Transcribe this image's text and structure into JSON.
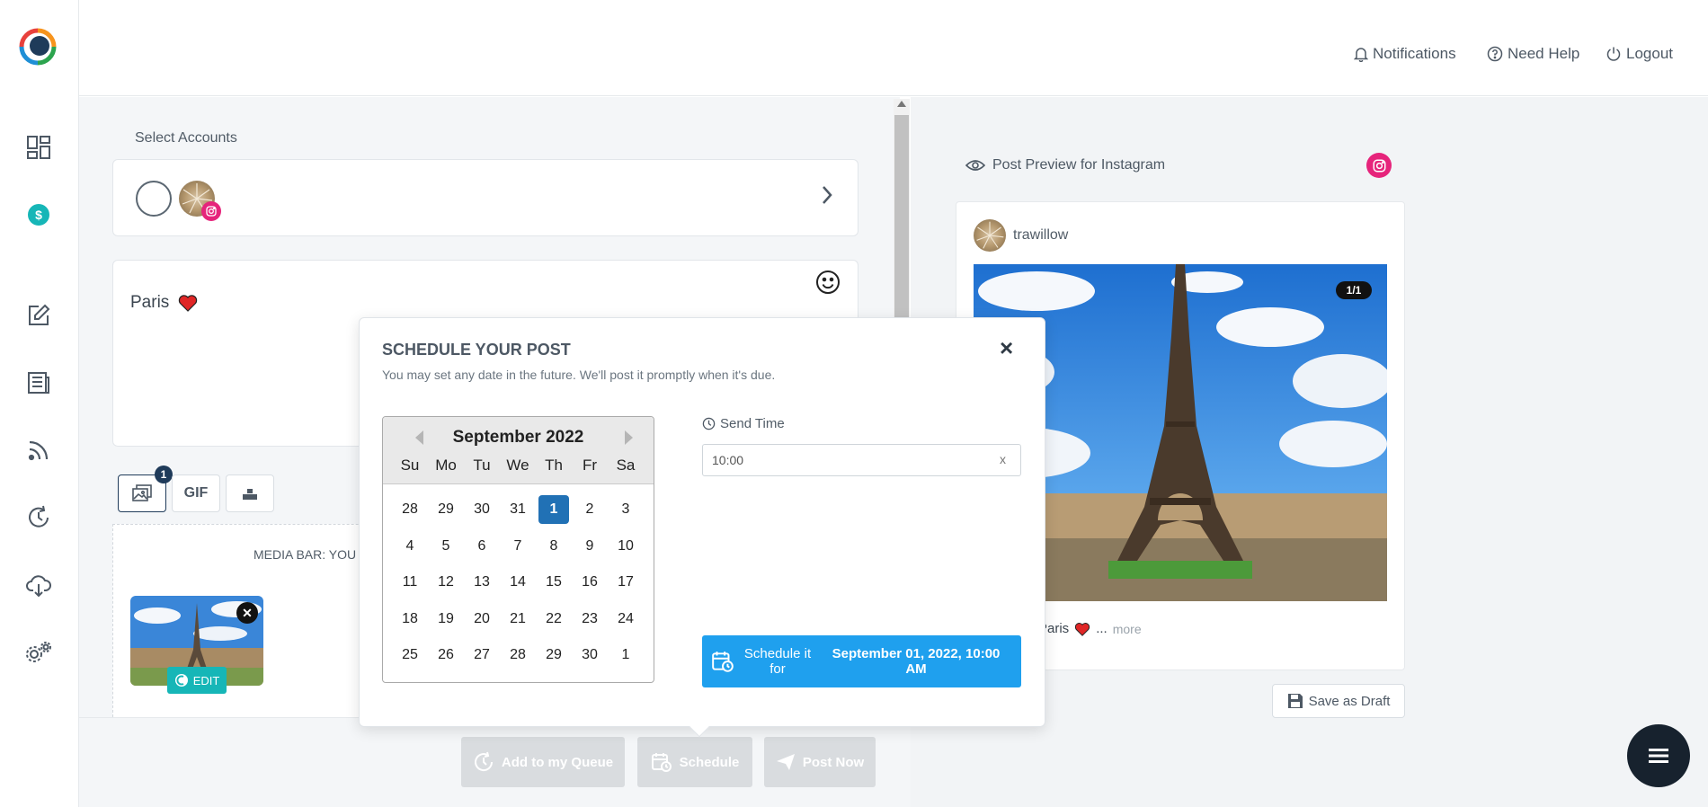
{
  "topbar": {
    "notifications": "Notifications",
    "help": "Need Help",
    "logout": "Logout"
  },
  "compose": {
    "select_accounts_label": "Select Accounts",
    "post_text": "Paris",
    "media_count": "1",
    "gif_label": "GIF",
    "media_bar_text": "MEDIA BAR: YOU",
    "edit_label": "EDIT"
  },
  "actions": {
    "queue": "Add to my Queue",
    "schedule": "Schedule",
    "post_now": "Post Now"
  },
  "preview": {
    "title": "Post Preview for Instagram",
    "username": "trawillow",
    "counter": "1/1",
    "caption": "Paris",
    "ellipsis": "...",
    "more": "more",
    "save_draft": "Save as Draft"
  },
  "modal": {
    "title": "SCHEDULE YOUR POST",
    "subtitle": "You may set any date in the future. We'll post it promptly when it's due.",
    "close": "×",
    "send_time_label": "Send Time",
    "send_time_value": "10:00",
    "clear": "x",
    "schedule_btn_line1": "Schedule it for",
    "schedule_btn_line2": "September 01, 2022, 10:00 AM"
  },
  "calendar": {
    "month": "September 2022",
    "dow": [
      "Su",
      "Mo",
      "Tu",
      "We",
      "Th",
      "Fr",
      "Sa"
    ],
    "weeks": [
      [
        "28",
        "29",
        "30",
        "31",
        "1",
        "2",
        "3"
      ],
      [
        "4",
        "5",
        "6",
        "7",
        "8",
        "9",
        "10"
      ],
      [
        "11",
        "12",
        "13",
        "14",
        "15",
        "16",
        "17"
      ],
      [
        "18",
        "19",
        "20",
        "21",
        "22",
        "23",
        "24"
      ],
      [
        "25",
        "26",
        "27",
        "28",
        "29",
        "30",
        "1"
      ]
    ],
    "selected": "1"
  },
  "colors": {
    "accent": "#1fa0ee",
    "selected_day": "#2171b5",
    "instagram": "#e6247b",
    "teal": "#16b6b7"
  }
}
